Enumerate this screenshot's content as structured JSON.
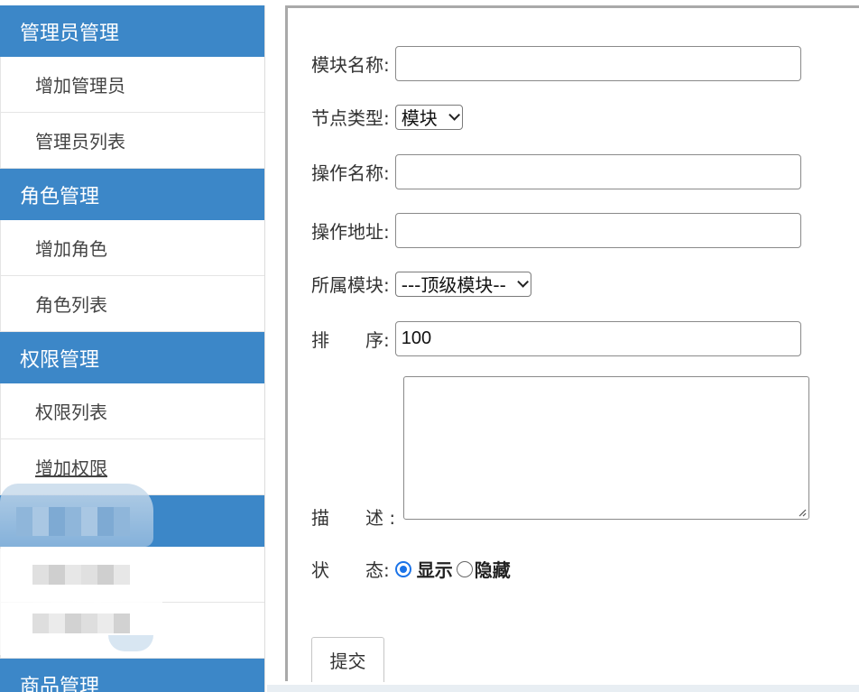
{
  "sidebar": {
    "groups": [
      {
        "title": "管理员管理",
        "items": [
          "增加管理员",
          "管理员列表"
        ]
      },
      {
        "title": "角色管理",
        "items": [
          "增加角色",
          "角色列表"
        ]
      },
      {
        "title": "权限管理",
        "items": [
          "权限列表",
          "增加权限"
        ]
      },
      {
        "title": "",
        "items": [
          "",
          ""
        ]
      },
      {
        "title": "商品管理",
        "items": []
      }
    ]
  },
  "form": {
    "module_name": {
      "label": "模块名称:",
      "value": ""
    },
    "node_type": {
      "label": "节点类型:",
      "selected": "模块"
    },
    "action_name": {
      "label": "操作名称:",
      "value": ""
    },
    "action_url": {
      "label": "操作地址:",
      "value": ""
    },
    "parent_module": {
      "label": "所属模块:",
      "selected": "---顶级模块--"
    },
    "sort": {
      "label": "排　　序:",
      "value": "100"
    },
    "description": {
      "label": "描　　述 :",
      "value": ""
    },
    "status": {
      "label": "状　　态:",
      "options": [
        "显示",
        "隐藏"
      ],
      "selected": "显示"
    },
    "submit_label": "提交"
  },
  "colors": {
    "sidebar_header": "#3c87c8",
    "radio_accent": "#1a73e8"
  }
}
